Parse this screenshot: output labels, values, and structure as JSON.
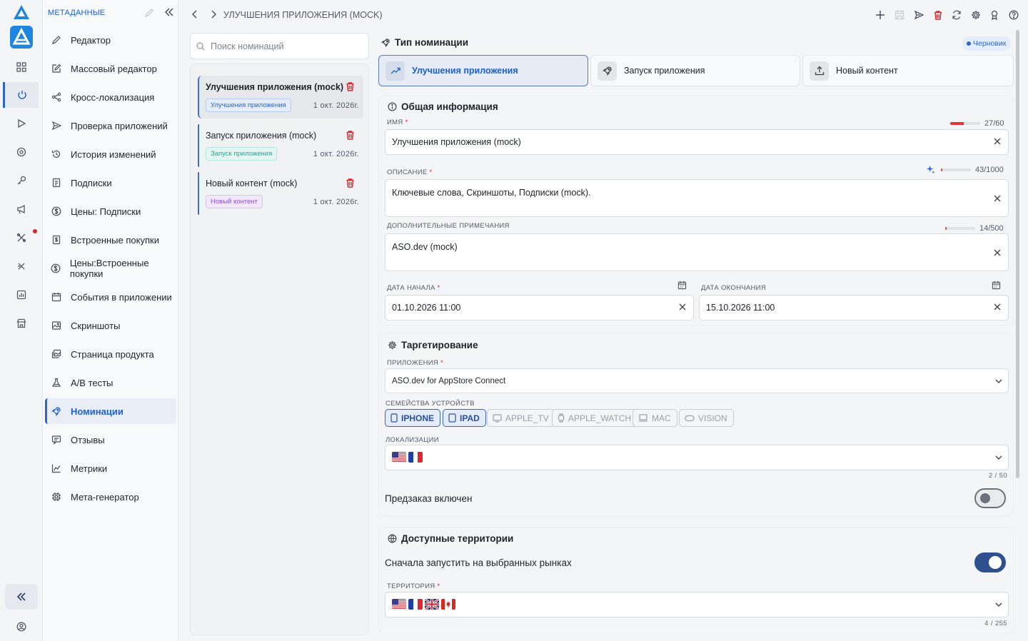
{
  "sidebar": {
    "heading": "МЕТАДАННЫЕ",
    "items": [
      {
        "label": "Редактор",
        "icon": "pencil-icon"
      },
      {
        "label": "Массовый редактор",
        "icon": "edit-square-icon"
      },
      {
        "label": "Кросс-локализация",
        "icon": "share-icon"
      },
      {
        "label": "Проверка приложений",
        "icon": "send-icon"
      },
      {
        "label": "История изменений",
        "icon": "history-icon"
      },
      {
        "label": "Подписки",
        "icon": "document-icon"
      },
      {
        "label": "Цены: Подписки",
        "icon": "dollar-icon"
      },
      {
        "label": "Встроенные покупки",
        "icon": "document-dollar-icon"
      },
      {
        "label": "Цены:Встроенные покупки",
        "icon": "dollar-icon"
      },
      {
        "label": "События в приложении",
        "icon": "calendar-icon"
      },
      {
        "label": "Скриншоты",
        "icon": "image-icon"
      },
      {
        "label": "Страница продукта",
        "icon": "images-icon"
      },
      {
        "label": "A/B тесты",
        "icon": "flask-icon"
      },
      {
        "label": "Номинации",
        "icon": "rocket-icon",
        "active": true
      },
      {
        "label": "Отзывы",
        "icon": "review-icon"
      },
      {
        "label": "Метрики",
        "icon": "chart-icon"
      },
      {
        "label": "Мета-генератор",
        "icon": "chip-icon"
      }
    ]
  },
  "header": {
    "breadcrumb": "УЛУЧШЕНИЯ ПРИЛОЖЕНИЯ (MOCK)"
  },
  "list": {
    "search_placeholder": "Поиск номинаций",
    "items": [
      {
        "title": "Улучшения приложения (mock)",
        "tag": "Улучшения приложения",
        "date": "1 окт. 2026г."
      },
      {
        "title": "Запуск приложения (mock)",
        "tag": "Запуск приложения",
        "date": "1 окт. 2026г."
      },
      {
        "title": "Новый контент (mock)",
        "tag": "Новый контент",
        "date": "1 окт. 2026г."
      }
    ]
  },
  "nomination_type": {
    "title": "Тип номинации",
    "status": "Черновик",
    "options": [
      "Улучшения приложения",
      "Запуск приложения",
      "Новый контент"
    ]
  },
  "general": {
    "title": "Общая информация",
    "name_label": "ИМЯ",
    "name_value": "Улучшения приложения (mock)",
    "name_counter": "27/60",
    "name_ratio": 0.45,
    "desc_label": "ОПИСАНИЕ",
    "desc_value": "Ключевые слова, Скриншоты, Подписки (mock).",
    "desc_counter": "43/1000",
    "desc_ratio": 0.043,
    "notes_label": "ДОПОЛНИТЕЛЬНЫЕ ПРИМЕЧАНИЯ",
    "notes_value": "ASO.dev (mock)",
    "notes_counter": "14/500",
    "notes_ratio": 0.028,
    "start_label": "ДАТА НАЧАЛА",
    "start_value": "01.10.2026 11:00",
    "end_label": "ДАТА ОКОНЧАНИЯ",
    "end_value": "15.10.2026 11:00"
  },
  "targeting": {
    "title": "Таргетирование",
    "apps_label": "ПРИЛОЖЕНИЯ",
    "apps_value": "ASO.dev for AppStore Connect",
    "families_label": "СЕМЕЙСТВА УСТРОЙСТВ",
    "families": [
      {
        "label": "IPHONE",
        "on": true,
        "icon": "phone-icon"
      },
      {
        "label": "IPAD",
        "on": true,
        "icon": "tablet-icon"
      },
      {
        "label": "APPLE_TV",
        "on": false,
        "icon": "tv-icon"
      },
      {
        "label": "APPLE_WATCH",
        "on": false,
        "icon": "watch-icon"
      },
      {
        "label": "MAC",
        "on": false,
        "icon": "laptop-icon"
      },
      {
        "label": "VISION",
        "on": false,
        "icon": "vision-icon"
      }
    ],
    "loc_label": "ЛОКАЛИЗАЦИИ",
    "loc_flags": [
      "us",
      "fr"
    ],
    "loc_count": "2 / 50",
    "preorder_label": "Предзаказ включен",
    "preorder_on": false
  },
  "territories": {
    "title": "Доступные территории",
    "first_label": "Сначала запустить на выбранных рынках",
    "first_on": true,
    "terr_label": "ТЕРРИТОРИЯ",
    "terr_flags": [
      "us",
      "fr",
      "gb",
      "ca"
    ],
    "terr_count": "4 / 255"
  },
  "colors": {
    "accent": "#1e5fd1",
    "danger": "#d8262b",
    "toggle_on": "#2f4f8f"
  }
}
